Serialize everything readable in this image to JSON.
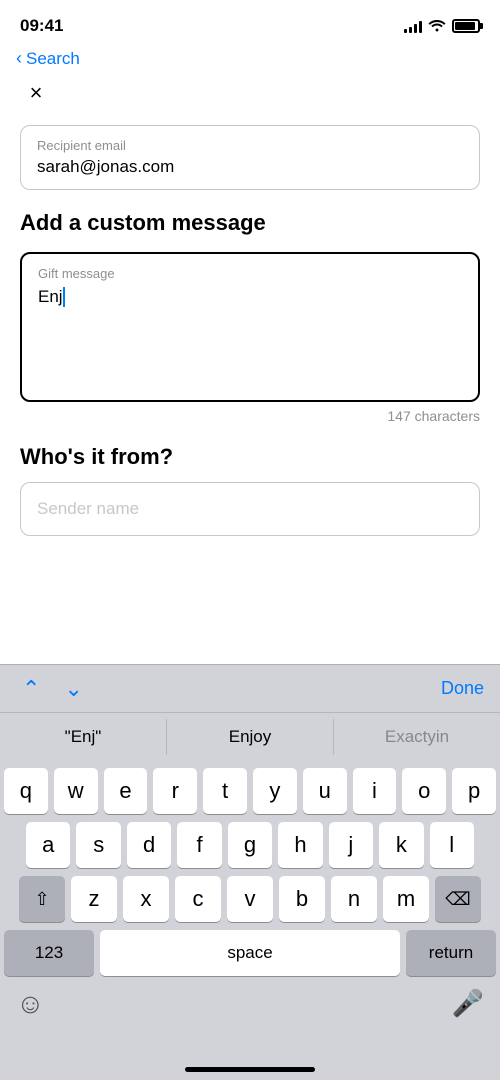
{
  "status": {
    "time": "09:41",
    "signal_bars": [
      4,
      6,
      8,
      11,
      14
    ],
    "battery_percent": 90
  },
  "nav": {
    "back_label": "Search"
  },
  "close_button_label": "×",
  "recipient_field": {
    "label": "Recipient email",
    "value": "sarah@jonas.com"
  },
  "custom_message_section": {
    "title": "Add a custom message",
    "gift_message_label": "Gift message",
    "current_text": "Enj",
    "char_count": "147 characters"
  },
  "sender_section": {
    "title": "Who's it from?",
    "placeholder": "Sender name"
  },
  "toolbar": {
    "done_label": "Done"
  },
  "autocomplete": {
    "items": [
      "\"Enj\"",
      "Enjoy",
      "Exactyin"
    ]
  },
  "keyboard": {
    "rows": [
      [
        "q",
        "w",
        "e",
        "r",
        "t",
        "y",
        "u",
        "i",
        "o",
        "p"
      ],
      [
        "a",
        "s",
        "d",
        "f",
        "g",
        "h",
        "j",
        "k",
        "l"
      ],
      [
        "z",
        "x",
        "c",
        "v",
        "b",
        "n",
        "m"
      ],
      [
        "123",
        "space",
        "return"
      ]
    ]
  }
}
